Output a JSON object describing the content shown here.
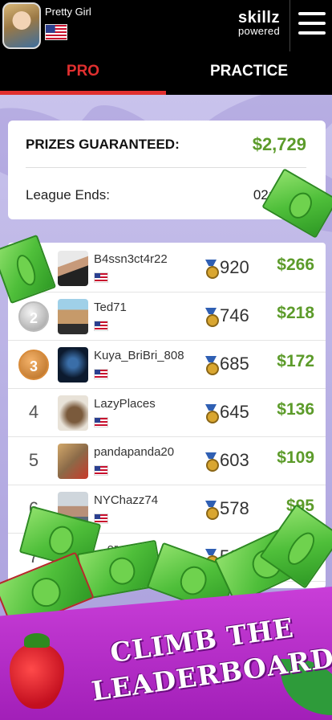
{
  "header": {
    "username": "Pretty Girl",
    "brand_top": "skillz",
    "brand_bottom": "powered"
  },
  "tabs": [
    {
      "label": "PRO",
      "active": true
    },
    {
      "label": "PRACTICE",
      "active": false
    }
  ],
  "info": {
    "prizes_label": "PRIZES GUARANTEED:",
    "prizes_value": "$2,729",
    "league_label": "League Ends:",
    "league_value": "02:10:16"
  },
  "leaderboard": [
    {
      "rank": "1",
      "name": "B4ssn3ct4r22",
      "score": "920",
      "prize": "$266"
    },
    {
      "rank": "2",
      "name": "Ted71",
      "score": "746",
      "prize": "$218"
    },
    {
      "rank": "3",
      "name": "Kuya_BriBri_808",
      "score": "685",
      "prize": "$172"
    },
    {
      "rank": "4",
      "name": "LazyPlaces",
      "score": "645",
      "prize": "$136"
    },
    {
      "rank": "5",
      "name": "pandapanda20",
      "score": "603",
      "prize": "$109"
    },
    {
      "rank": "6",
      "name": "NYChazz74",
      "score": "578",
      "prize": "$95"
    },
    {
      "rank": "7",
      "name": "__er__",
      "score": "524",
      "prize": ""
    }
  ],
  "banner": {
    "line1": "CLIMB THE",
    "line2": "LEADERBOARD"
  },
  "colors": {
    "accent_red": "#e02f2f",
    "prize_green": "#5c9b2a",
    "banner_purple": "#b52ac8"
  }
}
